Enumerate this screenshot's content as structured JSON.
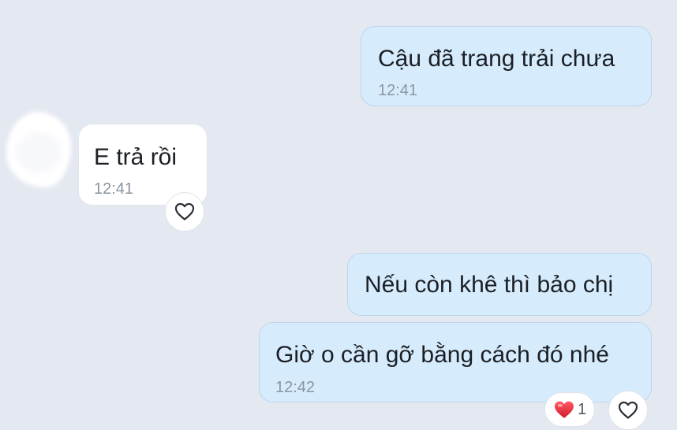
{
  "messages": [
    {
      "direction": "outgoing",
      "text": "Cậu đã trang trải chưa",
      "time": "12:41"
    },
    {
      "direction": "incoming",
      "text": "E trả rồi",
      "time": "12:41",
      "reaction_icon": "heart-outline-icon"
    },
    {
      "direction": "outgoing",
      "text": "Nếu còn khê thì bảo chị"
    },
    {
      "direction": "outgoing",
      "text": "Giờ o cần gỡ bằng cách đó nhé",
      "time": "12:42",
      "reaction": {
        "icon": "heart-red-icon",
        "count": "1"
      },
      "reaction_icon": "heart-outline-icon"
    }
  ],
  "colors": {
    "background": "#e4e8f1",
    "outgoing_bubble": "#d6ecfd",
    "incoming_bubble": "#ffffff",
    "heart_red": "#e0283a"
  }
}
